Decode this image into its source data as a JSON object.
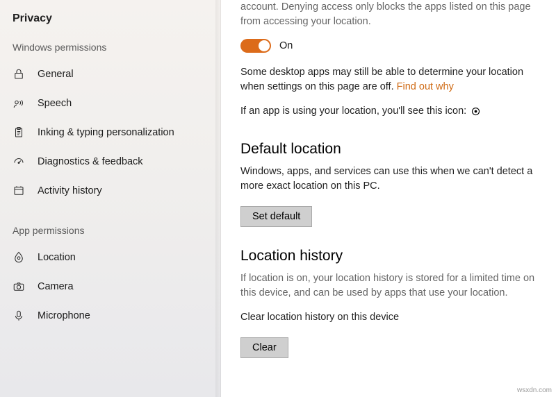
{
  "sidebar": {
    "title": "Privacy",
    "groups": [
      {
        "label": "Windows permissions",
        "items": [
          {
            "icon": "lock-icon",
            "label": "General"
          },
          {
            "icon": "speech-icon",
            "label": "Speech"
          },
          {
            "icon": "clipboard-icon",
            "label": "Inking & typing personalization"
          },
          {
            "icon": "diagnostics-icon",
            "label": "Diagnostics & feedback"
          },
          {
            "icon": "history-icon",
            "label": "Activity history"
          }
        ]
      },
      {
        "label": "App permissions",
        "items": [
          {
            "icon": "location-icon",
            "label": "Location"
          },
          {
            "icon": "camera-icon",
            "label": "Camera"
          },
          {
            "icon": "microphone-icon",
            "label": "Microphone"
          }
        ]
      }
    ]
  },
  "main": {
    "intro_partial": "account. Denying access only blocks the apps listed on this page from accessing your location.",
    "toggle": {
      "state": "On"
    },
    "desktop_apps_note": "Some desktop apps may still be able to determine your location when settings on this page are off. ",
    "find_out_why": "Find out why",
    "using_location_note": "If an app is using your location, you'll see this icon:",
    "default_location": {
      "title": "Default location",
      "desc": "Windows, apps, and services can use this when we can't detect a more exact location on this PC.",
      "button": "Set default"
    },
    "location_history": {
      "title": "Location history",
      "desc": "If location is on, your location history is stored for a limited time on this device, and can be used by apps that use your location.",
      "clear_label": "Clear location history on this device",
      "button": "Clear"
    }
  },
  "watermark": "wsxdn.com"
}
